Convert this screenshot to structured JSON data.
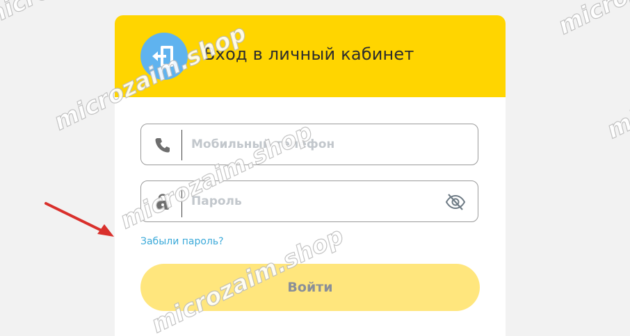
{
  "login": {
    "title": "Вход в личный кабинет",
    "phone_placeholder": "Мобильный телефон",
    "password_placeholder": "Пароль",
    "forgot_password": "Забыли пароль?",
    "submit_label": "Войти"
  },
  "icons": {
    "header": "login-door-icon",
    "phone": "phone-icon",
    "lock": "lock-icon",
    "password_toggle": "eye-off-icon"
  },
  "colors": {
    "header_bg": "#ffd500",
    "icon_circle": "#5fb3ef",
    "link": "#3aa9d9",
    "button_bg": "#ffe67d",
    "button_text": "#8a8f98",
    "arrow": "#d9302c"
  },
  "watermark": "microzaim.shop"
}
